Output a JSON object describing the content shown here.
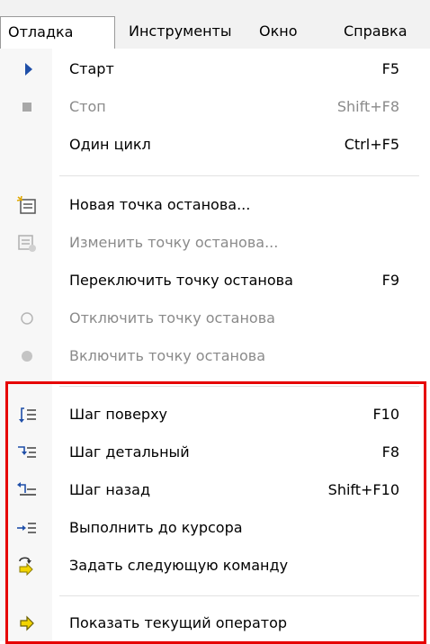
{
  "menubar": {
    "items": [
      "Отладка",
      "Инструменты",
      "Окно",
      "Справка"
    ]
  },
  "menu": {
    "items": [
      {
        "label": "Старт",
        "shortcut": "F5",
        "icon": "play-icon",
        "enabled": true
      },
      {
        "label": "Стоп",
        "shortcut": "Shift+F8",
        "icon": "stop-icon",
        "enabled": false
      },
      {
        "label": "Один цикл",
        "shortcut": "Ctrl+F5",
        "icon": "",
        "enabled": true
      },
      {
        "label": "Новая точка останова...",
        "shortcut": "",
        "icon": "new-breakpoint-icon",
        "enabled": true
      },
      {
        "label": "Изменить точку останова...",
        "shortcut": "",
        "icon": "edit-breakpoint-icon",
        "enabled": false
      },
      {
        "label": "Переключить точку останова",
        "shortcut": "F9",
        "icon": "",
        "enabled": true
      },
      {
        "label": "Отключить точку останова",
        "shortcut": "",
        "icon": "empty-circle-icon",
        "enabled": false
      },
      {
        "label": "Включить точку останова",
        "shortcut": "",
        "icon": "filled-circle-icon",
        "enabled": false
      },
      {
        "label": "Шаг поверху",
        "shortcut": "F10",
        "icon": "step-over-icon",
        "enabled": true
      },
      {
        "label": "Шаг детальный",
        "shortcut": "F8",
        "icon": "step-into-icon",
        "enabled": true
      },
      {
        "label": "Шаг назад",
        "shortcut": "Shift+F10",
        "icon": "step-back-icon",
        "enabled": true
      },
      {
        "label": "Выполнить до курсора",
        "shortcut": "",
        "icon": "run-to-cursor-icon",
        "enabled": true
      },
      {
        "label": "Задать следующую команду",
        "shortcut": "",
        "icon": "set-next-statement-icon",
        "enabled": true
      },
      {
        "label": "Показать текущий оператор",
        "shortcut": "",
        "icon": "show-current-statement-icon",
        "enabled": true
      }
    ]
  },
  "colors": {
    "highlight_border": "#e60000",
    "play_icon": "#1f4fa8",
    "arrow_icon": "#f2c200",
    "disabled_text": "#8a8a8a"
  }
}
